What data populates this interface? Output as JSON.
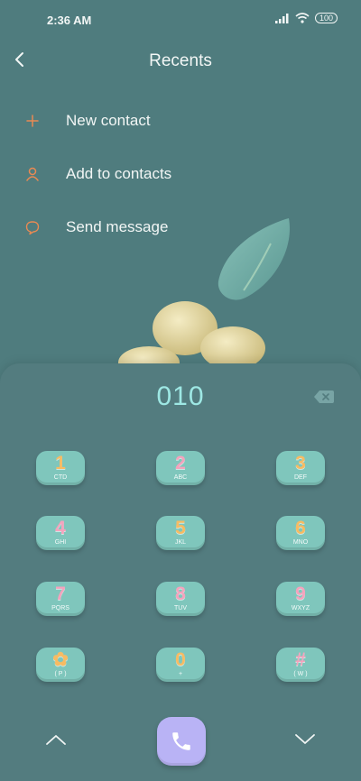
{
  "status_bar": {
    "time": "2:36 AM",
    "battery": "100"
  },
  "header": {
    "title": "Recents"
  },
  "menu": [
    {
      "label": "New contact",
      "icon": "plus-icon"
    },
    {
      "label": "Add to contacts",
      "icon": "person-icon"
    },
    {
      "label": "Send message",
      "icon": "message-icon"
    }
  ],
  "dialer": {
    "number": "010",
    "keys": [
      {
        "digit": "1",
        "letters": "CTD"
      },
      {
        "digit": "2",
        "letters": "ABC"
      },
      {
        "digit": "3",
        "letters": "DEF"
      },
      {
        "digit": "4",
        "letters": "GHI"
      },
      {
        "digit": "5",
        "letters": "JKL"
      },
      {
        "digit": "6",
        "letters": "MNO"
      },
      {
        "digit": "7",
        "letters": "PQRS"
      },
      {
        "digit": "8",
        "letters": "TUV"
      },
      {
        "digit": "9",
        "letters": "WXYZ"
      },
      {
        "digit": "✿",
        "letters": "( P )"
      },
      {
        "digit": "0",
        "letters": "+"
      },
      {
        "digit": "#",
        "letters": "( W )"
      }
    ]
  },
  "colors": {
    "background": "#4f7c7e",
    "key": "#7fc6bc",
    "digit_pink": "#f4a3bd",
    "digit_orange": "#f7bb63",
    "call_button": "#b9b3f5",
    "menu_icon": "#e98a53",
    "number": "#9ee8e4"
  }
}
